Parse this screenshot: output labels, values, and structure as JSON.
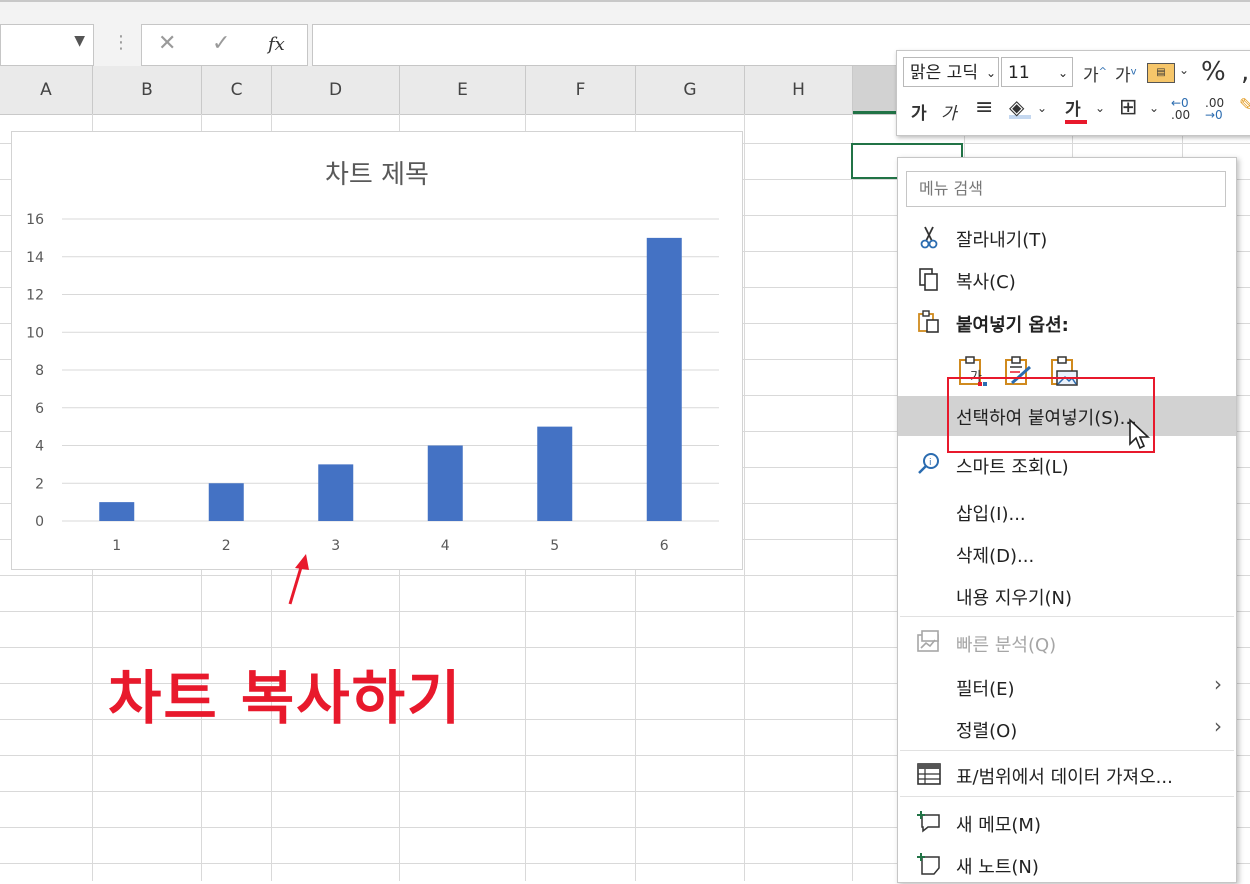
{
  "formula_bar": {
    "fx_label": "fx"
  },
  "columns": [
    "A",
    "B",
    "C",
    "D",
    "E",
    "F",
    "G",
    "H"
  ],
  "chart_data": {
    "type": "bar",
    "title": "차트 제목",
    "categories": [
      "1",
      "2",
      "3",
      "4",
      "5",
      "6"
    ],
    "values": [
      1,
      2,
      3,
      4,
      5,
      15
    ],
    "ylim": [
      0,
      16
    ],
    "yticks": [
      "0",
      "2",
      "4",
      "6",
      "8",
      "10",
      "12",
      "14",
      "16"
    ],
    "grid": true,
    "bar_color": "#4472c4"
  },
  "annotation": {
    "text": "차트 복사하기",
    "color": "#e8192c"
  },
  "mini_toolbar": {
    "font_name": "맑은 고딕",
    "font_size": "11",
    "grow_font": "가",
    "shrink_font": "가",
    "percent": "%",
    "bold": "가",
    "italic": "가",
    "font_color_glyph": "가",
    "inc_decimal": ".00",
    "dec_decimal": ".00"
  },
  "context_menu": {
    "search_placeholder": "메뉴 검색",
    "items": [
      {
        "label": "잘라내기(T)",
        "icon": "scissors-icon"
      },
      {
        "label": "복사(C)",
        "icon": "copy-icon"
      },
      {
        "label": "붙여넣기 옵션:",
        "icon": "clipboard-icon"
      },
      {
        "label": "선택하여 붙여넣기(S)...",
        "icon": ""
      },
      {
        "label": "스마트 조회(L)",
        "icon": "smart-lookup-icon"
      },
      {
        "label": "삽입(I)...",
        "icon": ""
      },
      {
        "label": "삭제(D)...",
        "icon": ""
      },
      {
        "label": "내용 지우기(N)",
        "icon": ""
      },
      {
        "label": "빠른 분석(Q)",
        "icon": "quick-analysis-icon"
      },
      {
        "label": "필터(E)",
        "icon": ""
      },
      {
        "label": "정렬(O)",
        "icon": ""
      },
      {
        "label": "표/범위에서 데이터 가져오...",
        "icon": "table-icon"
      },
      {
        "label": "새 메모(M)",
        "icon": "new-comment-icon"
      },
      {
        "label": "새 노트(N)",
        "icon": "new-note-icon"
      }
    ]
  }
}
